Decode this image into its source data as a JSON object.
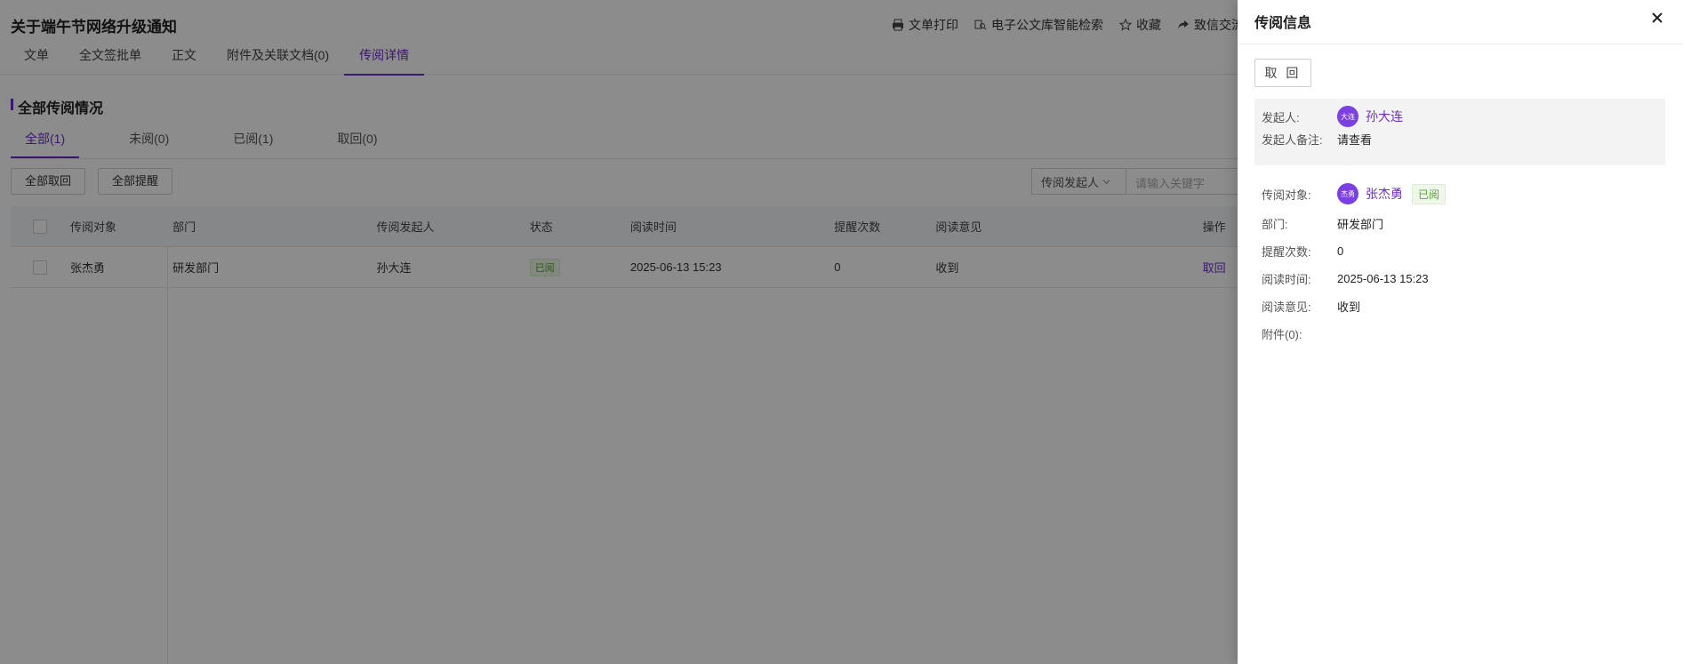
{
  "doc": {
    "title": "关于端午节网络升级通知"
  },
  "toolbar": [
    {
      "icon": "print-icon",
      "label": "文单打印"
    },
    {
      "icon": "search-doc-icon",
      "label": "电子公文库智能检索"
    },
    {
      "icon": "star-icon",
      "label": "收藏"
    },
    {
      "icon": "share-icon",
      "label": "致信交流"
    }
  ],
  "tabs": [
    "文单",
    "全文签批单",
    "正文",
    "附件及关联文档(0)",
    "传阅详情"
  ],
  "active_tab": "传阅详情",
  "section": {
    "title": "全部传阅情况"
  },
  "sub_tabs": [
    "全部(1)",
    "未阅(0)",
    "已阅(1)",
    "取回(0)"
  ],
  "actions": {
    "withdraw_all": "全部取回",
    "remind_all": "全部提醒"
  },
  "filter": {
    "select": "传阅发起人",
    "placeholder": "请输入关键字"
  },
  "table": {
    "headers": [
      "传阅对象",
      "部门",
      "传阅发起人",
      "状态",
      "阅读时间",
      "提醒次数",
      "阅读意见",
      "操作"
    ],
    "rows": [
      {
        "target": "张杰勇",
        "dept": "研发部门",
        "initiator": "孙大连",
        "status": "已阅",
        "read_time": "2025-06-13 15:23",
        "reminders": "0",
        "opinion": "收到",
        "op": "取回"
      }
    ]
  },
  "drawer": {
    "title": "传阅信息",
    "withdraw": "取 回",
    "initiator_label": "发起人:",
    "initiator_avatar": "大连",
    "initiator_name": "孙大连",
    "remark_label": "发起人备注:",
    "remark": "请查看",
    "target_label": "传阅对象:",
    "target_avatar": "杰勇",
    "target_name": "张杰勇",
    "target_status": "已阅",
    "dept_label": "部门:",
    "dept": "研发部门",
    "remind_label": "提醒次数:",
    "remind": "0",
    "time_label": "阅读时间:",
    "time": "2025-06-13 15:23",
    "opinion_label": "阅读意见:",
    "opinion": "收到",
    "attach_label": "附件(0):"
  },
  "colors": {
    "accent": "#6b2fc9",
    "avatar": "#7b3fe4",
    "read_tag": "#5aa23a"
  }
}
